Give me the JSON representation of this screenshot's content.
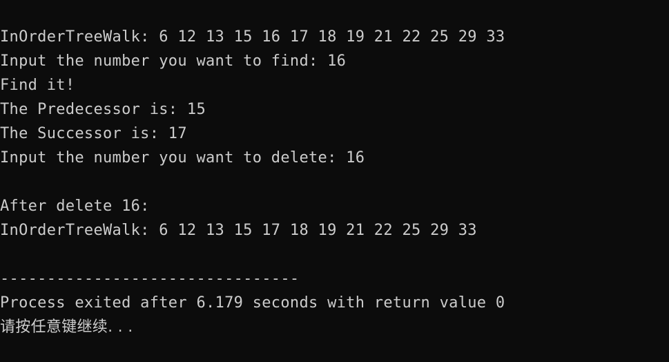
{
  "window": {
    "background": "#0c0c0c",
    "text_color": "#cccccc"
  },
  "console": {
    "lines": [
      "InOrderTreeWalk: 6 12 13 15 16 17 18 19 21 22 25 29 33",
      "Input the number you want to find: 16",
      "Find it!",
      "The Predecessor is: 15",
      "The Successor is: 17",
      "Input the number you want to delete: 16",
      "",
      "After delete 16:",
      "InOrderTreeWalk: 6 12 13 15 17 18 19 21 22 25 29 33",
      "",
      "--------------------------------",
      "Process exited after 6.179 seconds with return value 0",
      "请按任意键继续. . ."
    ]
  }
}
